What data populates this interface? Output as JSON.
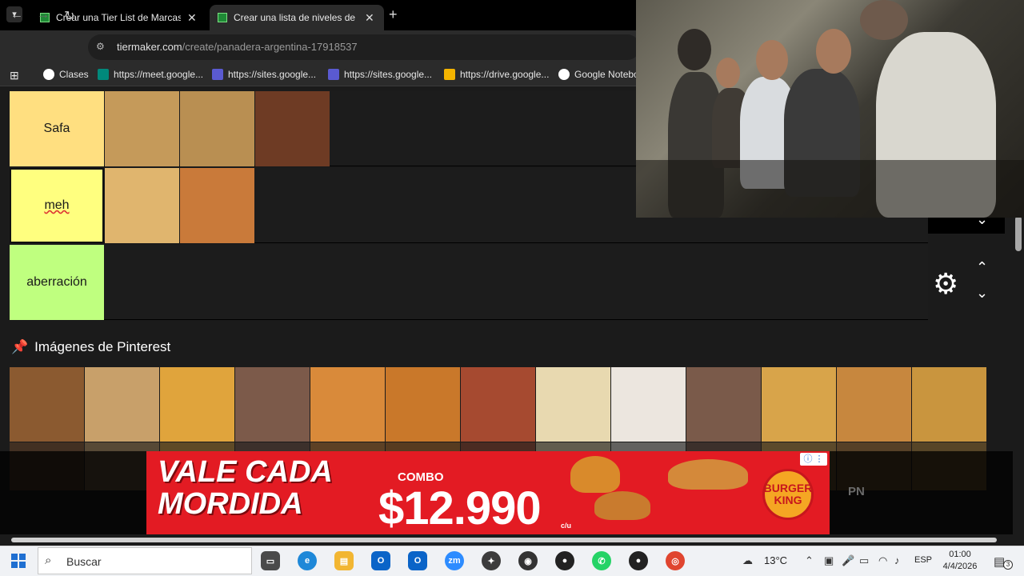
{
  "browser": {
    "tabs": [
      {
        "title": "Crear una Tier List de Marcas de",
        "active": false
      },
      {
        "title": "Crear una lista de niveles de pa",
        "active": true
      }
    ],
    "url_host": "tiermaker.com",
    "url_path": "/create/panadera-argentina-17918537",
    "bookmarks": [
      {
        "label": "Clases",
        "icon": "google-icon",
        "color": "#ffffff"
      },
      {
        "label": "https://meet.google...",
        "icon": "meet-icon",
        "color": "#00897b"
      },
      {
        "label": "https://sites.google...",
        "icon": "sites-icon",
        "color": "#5a5ad1"
      },
      {
        "label": "https://sites.google...",
        "icon": "sites-icon",
        "color": "#5a5ad1"
      },
      {
        "label": "https://drive.google...",
        "icon": "drive-icon",
        "color": "#f4b400"
      },
      {
        "label": "Google Notebo",
        "icon": "notebook-icon",
        "color": "#ffffff"
      }
    ]
  },
  "tiers": [
    {
      "label": "Safa",
      "color": "#ffdf80",
      "tiles": [
        "#c59a5a",
        "#b98f52",
        "#6e3b24"
      ]
    },
    {
      "label": "meh",
      "color": "#ffff7f",
      "tiles": [
        "#e0b56e",
        "#c97a3a"
      ]
    },
    {
      "label": "aberración",
      "color": "#bfff7f",
      "tiles": []
    }
  ],
  "pinterest": {
    "heading": "Imágenes de Pinterest",
    "tiles": [
      "#8b5a30",
      "#c8a06a",
      "#e0a43c",
      "#7c5a4a",
      "#d98a3a",
      "#c9782a",
      "#a64a30",
      "#e8d9b0",
      "#ece6df",
      "#7a5a4a",
      "#d8a44a",
      "#c7873e",
      "#c9953e"
    ]
  },
  "ad": {
    "slogan_line1": "VALE CADA",
    "slogan_line2": "MORDIDA",
    "combo_label": "COMBO",
    "price": "$12.990",
    "unit": "c/u",
    "brand_line1": "BURGER",
    "brand_line2": "KING",
    "side_text": "PN"
  },
  "taskbar": {
    "search_placeholder": "Buscar",
    "temperature": "13°C",
    "language": "ESP",
    "time": "01:00",
    "date": "4/4/2026",
    "notification_count": "3",
    "apps": [
      {
        "name": "task-view-icon",
        "color": "#4a4a4a"
      },
      {
        "name": "edge-icon",
        "color": "#1e88d8"
      },
      {
        "name": "file-explorer-icon",
        "color": "#f2b632"
      },
      {
        "name": "outlook-icon",
        "color": "#0a64c8"
      },
      {
        "name": "outlook-new-icon",
        "color": "#0a64c8"
      },
      {
        "name": "zoom-icon",
        "color": "#2d8cff"
      },
      {
        "name": "app-icon",
        "color": "#3c3c3c"
      },
      {
        "name": "pokeball-icon",
        "color": "#333333"
      },
      {
        "name": "obs-icon",
        "color": "#222222"
      },
      {
        "name": "whatsapp-icon",
        "color": "#25d366"
      },
      {
        "name": "obs-alt-icon",
        "color": "#222222"
      },
      {
        "name": "chrome-icon",
        "color": "#e0452f"
      }
    ]
  }
}
